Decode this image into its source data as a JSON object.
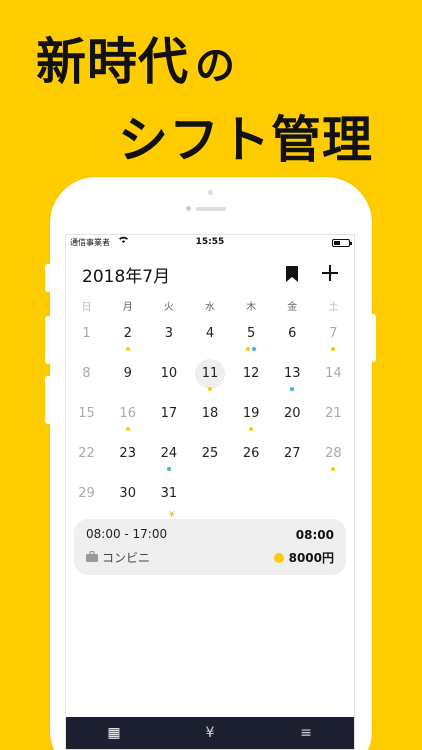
{
  "headline": {
    "line1_main": "新時代",
    "line1_small": "の",
    "line2": "シフト管理"
  },
  "statusbar": {
    "carrier": "通信事業者",
    "time": "15:55"
  },
  "calendar": {
    "month_title": "2018年7月",
    "weekdays": [
      "日",
      "月",
      "火",
      "水",
      "木",
      "金",
      "土"
    ],
    "days": [
      {
        "n": "1",
        "muted": true,
        "dots": []
      },
      {
        "n": "2",
        "muted": false,
        "dots": [
          "y"
        ]
      },
      {
        "n": "3",
        "muted": false,
        "dots": []
      },
      {
        "n": "4",
        "muted": false,
        "dots": []
      },
      {
        "n": "5",
        "muted": false,
        "dots": [
          "y",
          "b"
        ]
      },
      {
        "n": "6",
        "muted": false,
        "dots": []
      },
      {
        "n": "7",
        "muted": true,
        "dots": [
          "y"
        ]
      },
      {
        "n": "8",
        "muted": true,
        "dots": []
      },
      {
        "n": "9",
        "muted": false,
        "dots": []
      },
      {
        "n": "10",
        "muted": false,
        "dots": []
      },
      {
        "n": "11",
        "muted": false,
        "dots": [
          "y"
        ],
        "today": true
      },
      {
        "n": "12",
        "muted": false,
        "dots": []
      },
      {
        "n": "13",
        "muted": false,
        "dots": [
          "b"
        ]
      },
      {
        "n": "14",
        "muted": true,
        "dots": []
      },
      {
        "n": "15",
        "muted": true,
        "dots": []
      },
      {
        "n": "16",
        "muted": true,
        "dots": [
          "y"
        ]
      },
      {
        "n": "17",
        "muted": false,
        "dots": []
      },
      {
        "n": "18",
        "muted": false,
        "dots": []
      },
      {
        "n": "19",
        "muted": false,
        "dots": [
          "y"
        ]
      },
      {
        "n": "20",
        "muted": false,
        "dots": []
      },
      {
        "n": "21",
        "muted": true,
        "dots": []
      },
      {
        "n": "22",
        "muted": true,
        "dots": []
      },
      {
        "n": "23",
        "muted": false,
        "dots": []
      },
      {
        "n": "24",
        "muted": false,
        "dots": [
          "b"
        ]
      },
      {
        "n": "25",
        "muted": false,
        "dots": []
      },
      {
        "n": "26",
        "muted": false,
        "dots": []
      },
      {
        "n": "27",
        "muted": false,
        "dots": []
      },
      {
        "n": "28",
        "muted": true,
        "dots": [
          "y"
        ]
      },
      {
        "n": "29",
        "muted": true,
        "dots": []
      },
      {
        "n": "30",
        "muted": false,
        "dots": []
      },
      {
        "n": "31",
        "muted": false,
        "dots": [],
        "yen": "¥"
      }
    ]
  },
  "shift": {
    "time_range": "08:00 - 17:00",
    "start_time": "08:00",
    "place": "コンビニ",
    "pay": "8000円"
  },
  "tabbar": {
    "tabs": [
      {
        "icon": "calendar-icon",
        "glyph": "▦",
        "active": true
      },
      {
        "icon": "yen-icon",
        "glyph": "¥",
        "active": false
      },
      {
        "icon": "menu-icon",
        "glyph": "≡",
        "active": false
      }
    ]
  },
  "colors": {
    "background": "#FFCC00",
    "dot_yellow": "#FFCC00",
    "dot_blue": "#39B5E0",
    "tabbar": "#1c2030"
  }
}
